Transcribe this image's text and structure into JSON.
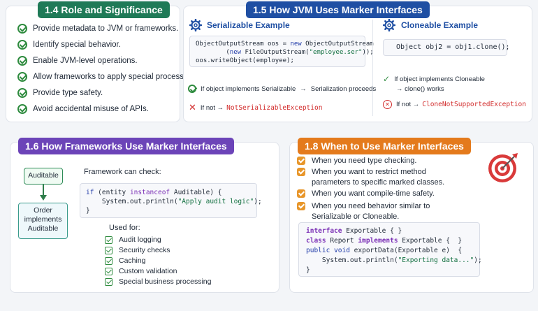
{
  "s14": {
    "title": "1.4 Role and Significance",
    "items": [
      "Provide metadata to JVM or frameworks.",
      "Identify special behavior.",
      "Enable JVM-level operations.",
      "Allow frameworks to apply special processing.",
      "Provide type safety.",
      "Avoid accidental misuse of APIs."
    ]
  },
  "s15": {
    "title": "1.5 How JVM Uses Marker Interfaces",
    "ser_heading": "Serializable Example",
    "ser_code_1": "ObjectOutputStream oos = ",
    "ser_code_new": "new",
    "ser_code_2": " ObjectOutputStream",
    "ser_code_3": "(",
    "ser_code_4": " FileOutputStream(",
    "ser_code_str": "\"employee.ser\"",
    "ser_code_5": "));",
    "ser_code_6": "oos.writeObject(employee);",
    "ser_ok_1": "If object implements Serializable",
    "ser_ok_arrow": "→",
    "ser_ok_2": "Serialization proceeds",
    "ser_no_1": "If not →",
    "ser_no_ex": "NotSerializableException",
    "clo_heading": "Cloneable Example",
    "clo_code": "Object obj2 = obj1.clone();",
    "clo_ok_1": "If object implements Cloneable",
    "clo_ok_2": "→ clone() works",
    "clo_no_1": "If not →",
    "clo_no_ex": "CloneNotSupportedException"
  },
  "s16": {
    "title": "1.6 How Frameworks Use Marker Interfaces",
    "box_top": "Auditable",
    "box_bottom_1": "Order",
    "box_bottom_2": "implements",
    "box_bottom_3": "Auditable",
    "check_label": "Framework can check:",
    "code_if": "if",
    "code_1": " (entity ",
    "code_instanceof": "instanceof",
    "code_2": " Auditable) {",
    "code_3": "    System.out.println(",
    "code_str": "\"Apply audit logic\"",
    "code_4": ");",
    "code_5": "}",
    "used_for": "Used for:",
    "uses": [
      "Audit logging",
      "Security checks",
      "Caching",
      "Custom validation",
      "Special business processing"
    ]
  },
  "s18": {
    "title": "1.8 When to Use Marker Interfaces",
    "items": [
      "When you need type checking.",
      "When you want to restrict method",
      "parameters to specific marked classes.",
      "When you want compile-time safety.",
      "When you need behavior similar to",
      "Serializable or Cloneable."
    ],
    "c_interface": "interface",
    "c_exportable_1": " Exportable { }",
    "c_class": "class",
    "c_report": " Report ",
    "c_implements": "implements",
    "c_exportable_2": " Exportable {  }",
    "c_public": "public",
    "c_void": " void",
    "c_export": " exportData(Exportable e)  {",
    "c_sys": "    System.out.println(",
    "c_str": "\"Exporting data...\"",
    "c_end": ");",
    "c_close": "}"
  },
  "colors": {
    "green": "#1f7a57",
    "blue": "#1f4fa3",
    "purple": "#6c44b8",
    "orange": "#e47a1c",
    "error": "#d22b2b"
  }
}
